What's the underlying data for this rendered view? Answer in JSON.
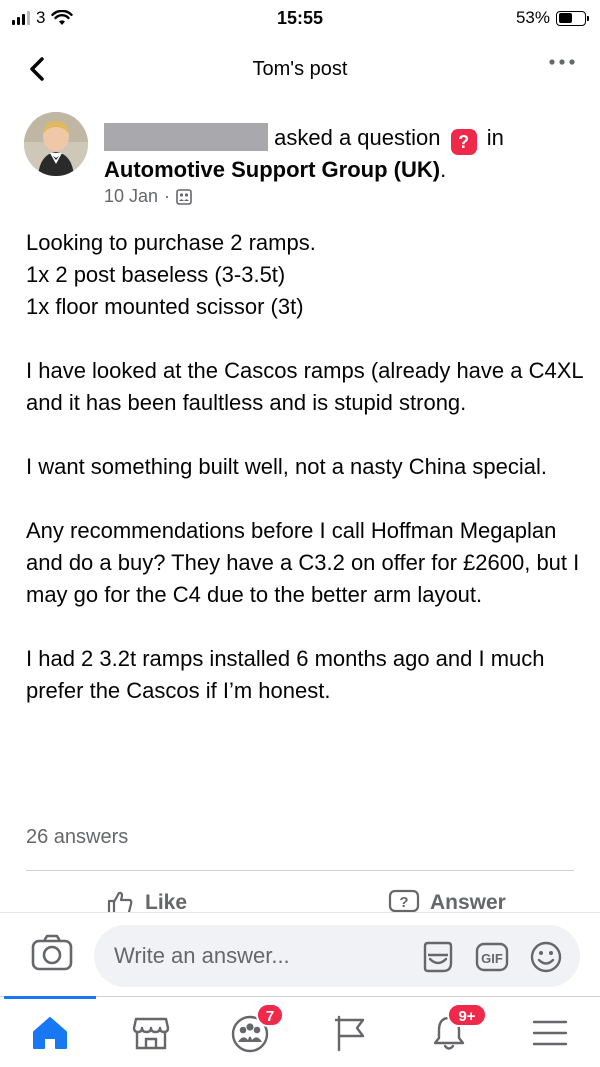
{
  "status_bar": {
    "carrier": "3",
    "time": "15:55",
    "battery": "53%",
    "battery_level": 0.53
  },
  "header": {
    "title": "Tom's post"
  },
  "post": {
    "action_text": "asked a question",
    "in_text": "in",
    "group": "Automotive Support Group (UK)",
    "group_suffix": ".",
    "date": "10 Jan",
    "separator": "·",
    "paragraphs": [
      [
        "Looking to purchase 2 ramps.",
        "1x 2 post baseless (3-3.5t)",
        "1x floor mounted scissor (3t)"
      ],
      [
        "I have looked at the Cascos ramps (already have a C4XL and it has been faultless and is stupid strong."
      ],
      [
        "I want something built well, not a nasty China special."
      ],
      [
        "Any recommendations before I call Hoffman Megaplan and do a buy? They have a C3.2 on offer for £2600, but I may go for the C4 due to the better arm layout."
      ],
      [
        "I had 2 3.2t ramps installed 6 months ago and I much prefer the Cascos if I’m honest."
      ]
    ],
    "answers_count": "26 answers"
  },
  "actions": {
    "like_label": "Like",
    "answer_label": "Answer"
  },
  "composer": {
    "placeholder": "Write an answer...",
    "icons": [
      "camera-icon",
      "sticker-icon",
      "gif-icon",
      "emoji-icon"
    ]
  },
  "tabbar": {
    "tabs": [
      {
        "icon": "home-icon",
        "active": true
      },
      {
        "icon": "marketplace-icon",
        "active": false
      },
      {
        "icon": "groups-icon",
        "badge": "7"
      },
      {
        "icon": "pages-flag-icon",
        "active": false
      },
      {
        "icon": "notifications-bell-icon",
        "badge": "9+"
      },
      {
        "icon": "menu-icon",
        "active": false
      }
    ]
  },
  "colors": {
    "accent": "#1877f2",
    "badge": "#f02849",
    "secondary_text": "#65676b"
  }
}
